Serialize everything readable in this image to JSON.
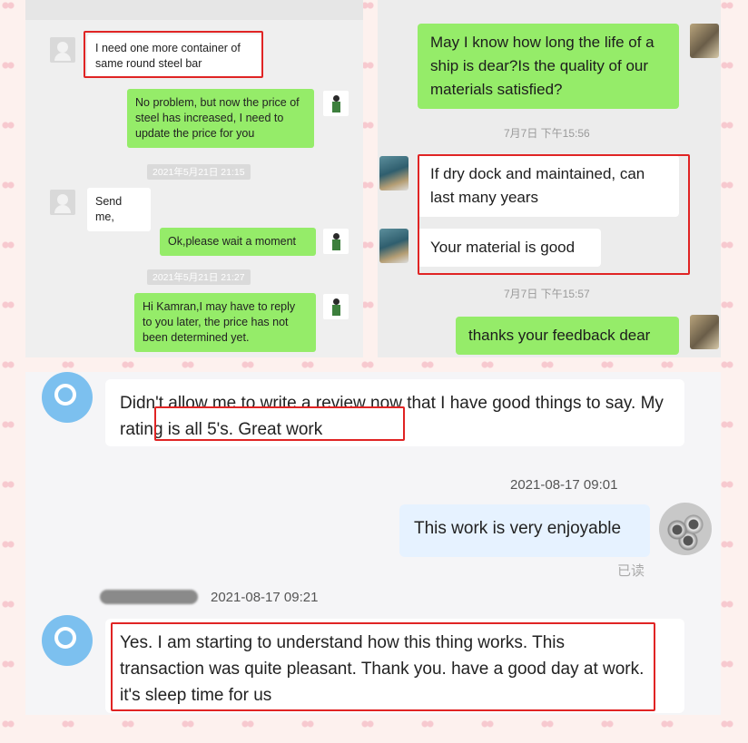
{
  "panel_left": {
    "messages": [
      {
        "side": "left",
        "text": "I need one more container of same round steel bar"
      },
      {
        "side": "right",
        "text": "No problem, but now the price of steel has increased, I need to update the price for you"
      },
      {
        "side": "left",
        "text": "Send me,"
      },
      {
        "side": "right",
        "text": "Ok,please wait a moment"
      },
      {
        "side": "right",
        "text": "Hi Kamran,I may have to reply to you later, the price has not been determined yet."
      }
    ],
    "timestamps": [
      "2021年5月21日 21:15",
      "2021年5月21日 21:27"
    ]
  },
  "panel_right": {
    "messages": [
      {
        "side": "right",
        "text": "May I know how long the life of a ship is dear?Is the quality of our materials satisfied?"
      },
      {
        "side": "left",
        "text": "If dry dock and maintained, can last many years"
      },
      {
        "side": "left",
        "text": "Your material is good"
      },
      {
        "side": "right",
        "text": "thanks your feedback dear"
      }
    ],
    "timestamps": [
      "7月7日 下午15:56",
      "7月7日 下午15:57"
    ]
  },
  "panel_bottom": {
    "msg1_pre": "Didn't allow me to write a review now that I have good things to say.",
    "msg1_highlight": "My rating is all 5's. Great work",
    "time_right": "2021-08-17 09:01",
    "msg2": "This work is very enjoyable",
    "read_status": "已读",
    "time_left": "2021-08-17 09:21",
    "msg3": "Yes. I am starting to understand how this thing works. This transaction was quite pleasant. Thank you. have a good day at work. it's sleep time for us"
  },
  "colors": {
    "wechat_green": "#95ec69",
    "highlight_red": "#e02424",
    "bubble_blue": "#e6f2ff"
  }
}
